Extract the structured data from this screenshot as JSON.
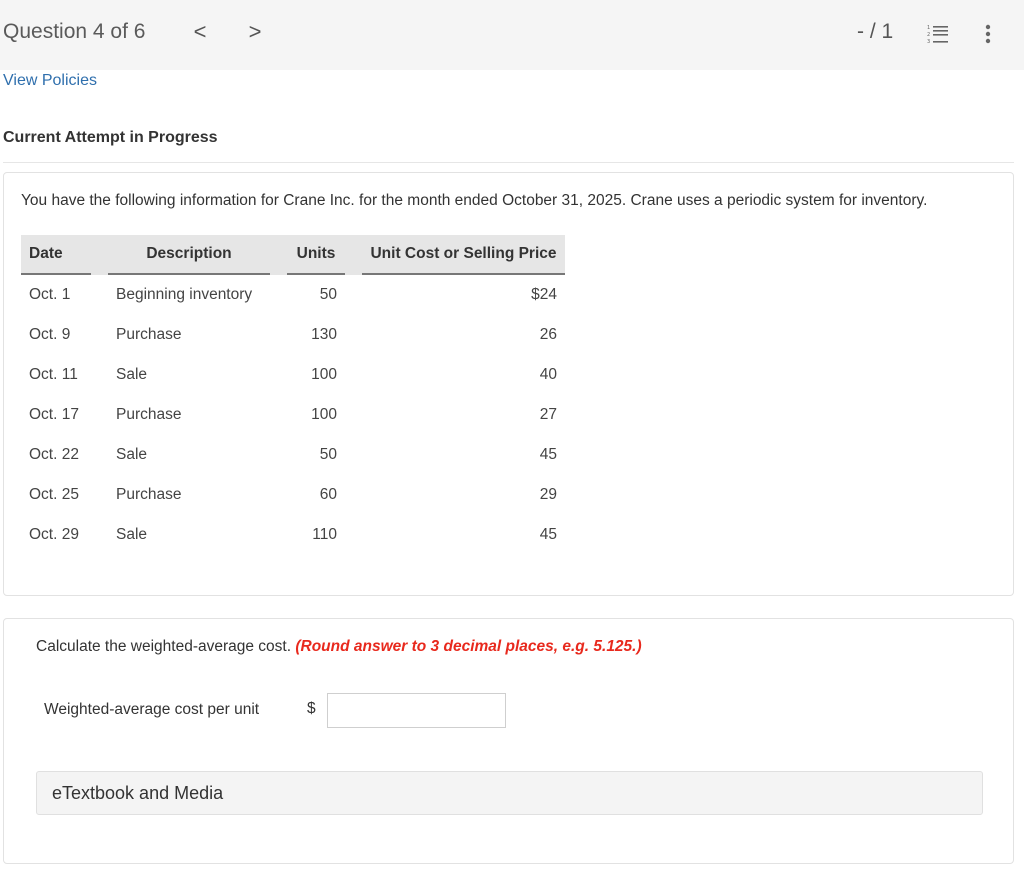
{
  "header": {
    "question_title": "Question 4 of 6",
    "prev_icon": "chevron-left-icon",
    "prev_glyph": "<",
    "next_icon": "chevron-right-icon",
    "next_glyph": ">",
    "score": "- / 1",
    "list_icon": "numbered-list-icon",
    "more_icon": "more-vertical-icon"
  },
  "links": {
    "view_policies": "View Policies"
  },
  "status": {
    "attempt": "Current Attempt in Progress"
  },
  "problem": {
    "intro": "You have the following information for Crane Inc. for the month ended October 31, 2025. Crane uses a periodic system for inventory.",
    "table": {
      "headers": [
        "Date",
        "Description",
        "Units",
        "Unit Cost or Selling Price"
      ],
      "rows": [
        {
          "date": "Oct. 1",
          "description": "Beginning inventory",
          "units": "50",
          "price": "$24"
        },
        {
          "date": "Oct. 9",
          "description": "Purchase",
          "units": "130",
          "price": "26"
        },
        {
          "date": "Oct. 11",
          "description": "Sale",
          "units": "100",
          "price": "40"
        },
        {
          "date": "Oct. 17",
          "description": "Purchase",
          "units": "100",
          "price": "27"
        },
        {
          "date": "Oct. 22",
          "description": "Sale",
          "units": "50",
          "price": "45"
        },
        {
          "date": "Oct. 25",
          "description": "Purchase",
          "units": "60",
          "price": "29"
        },
        {
          "date": "Oct. 29",
          "description": "Sale",
          "units": "110",
          "price": "45"
        }
      ]
    }
  },
  "question": {
    "prompt": "Calculate the weighted-average cost.",
    "hint": "(Round answer to 3 decimal places, e.g. 5.125.)",
    "hint_color": "#e8291d",
    "answer_label": "Weighted-average cost per unit",
    "currency_symbol": "$",
    "answer_value": "",
    "answer_placeholder": ""
  },
  "resources": {
    "etextbook_label": "eTextbook and Media"
  },
  "colors": {
    "link": "#2f6fad",
    "topbar_bg": "#f5f5f5",
    "table_header_bg": "#e6e6e6"
  }
}
